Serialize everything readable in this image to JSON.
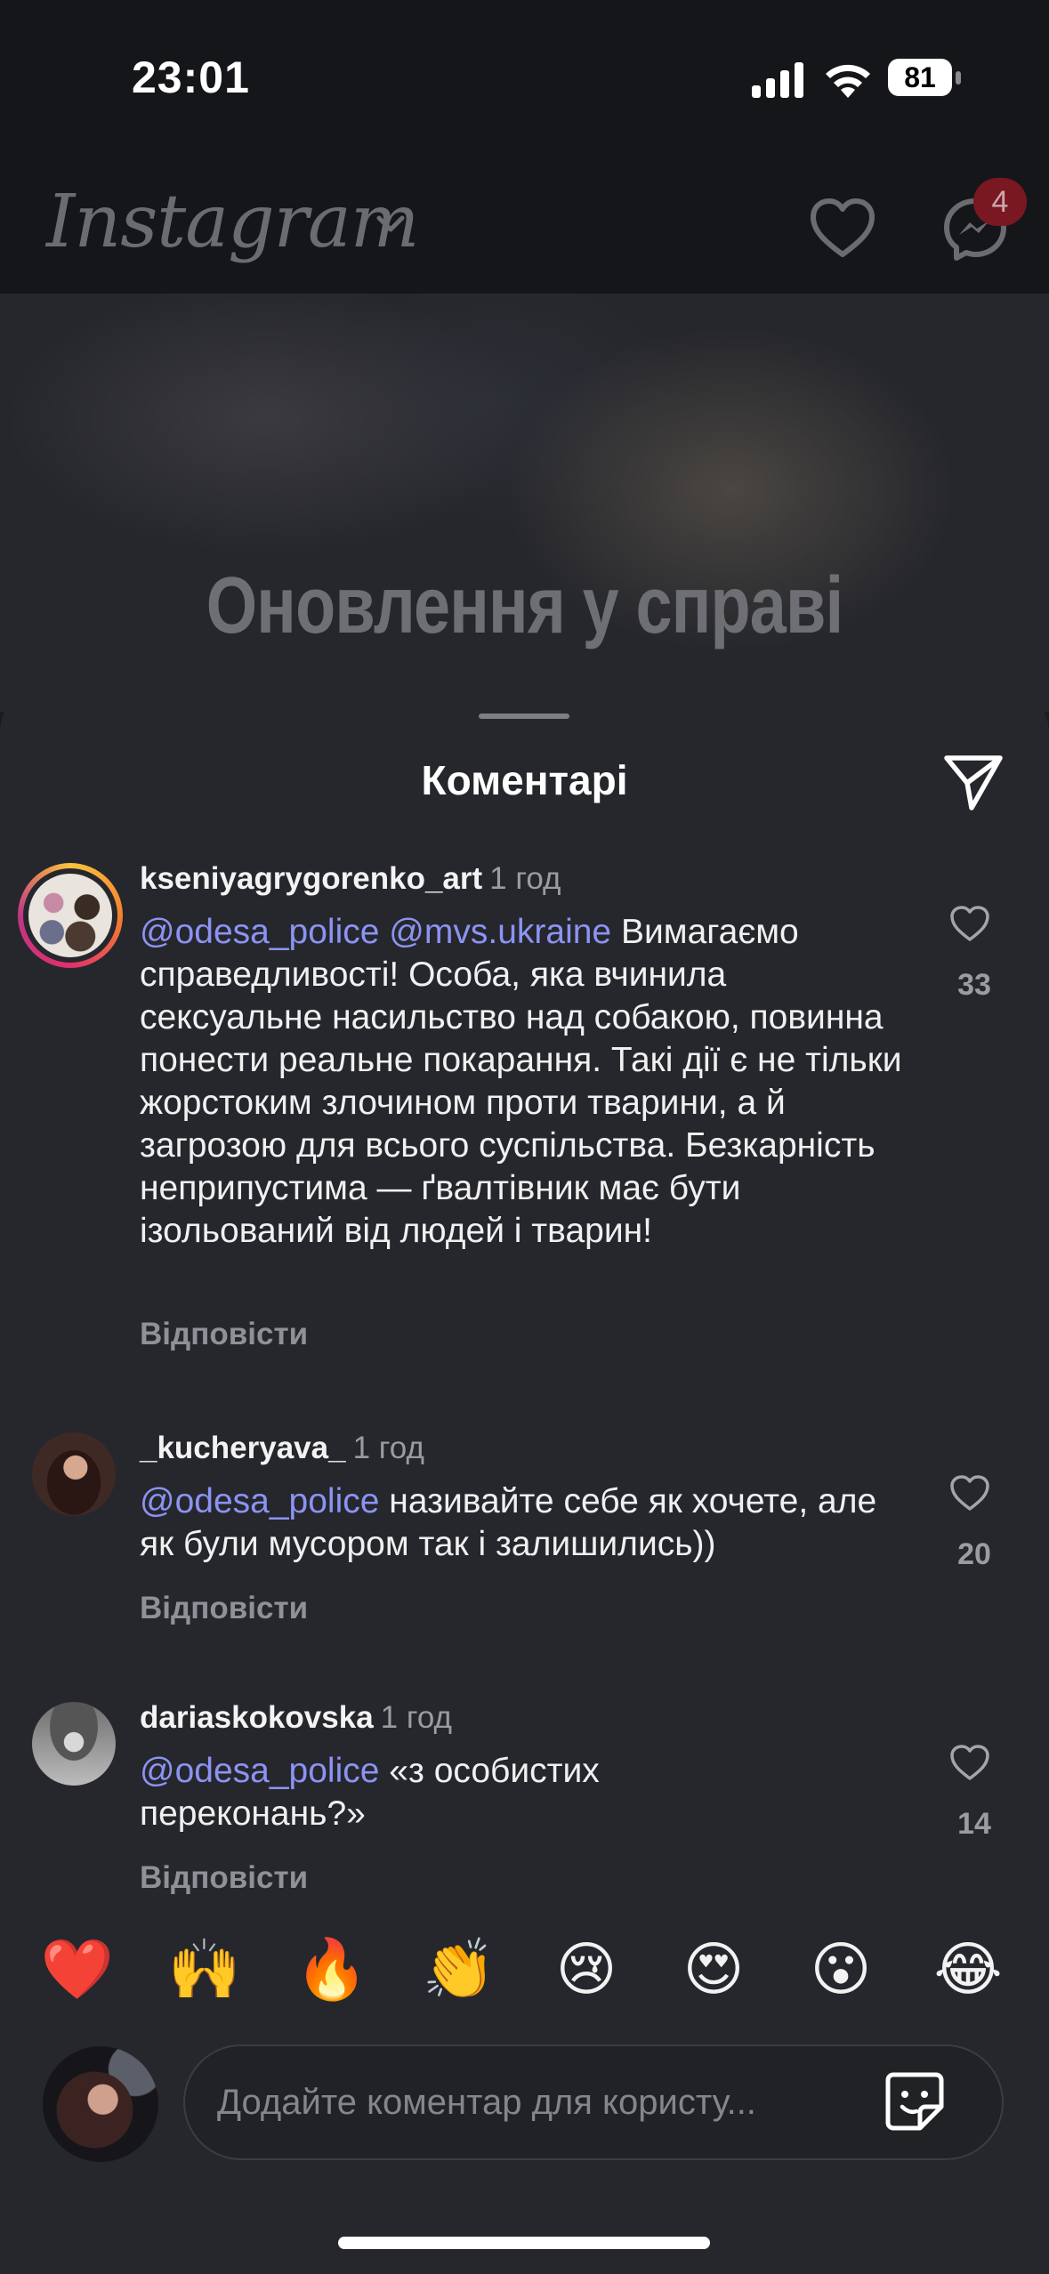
{
  "status_bar": {
    "time": "23:01",
    "battery": "81"
  },
  "header": {
    "logo": "Instagram",
    "messages_badge": "4"
  },
  "post": {
    "overlay_text": "Оновлення у справі"
  },
  "sheet": {
    "title": "Коментарі"
  },
  "comments": [
    {
      "username": "kseniyagrygorenko_art",
      "time": "1 год",
      "mentions": [
        "@odesa_police",
        "@mvs.ukraine"
      ],
      "text": "Вимагаємо справедливості! Особа, яка вчинила сексуальне насильство над собакою, повинна понести реальне покарання. Такі дії є не тільки жорстоким злочином проти тварини, а й загрозою для всього суспільства. Безкарність неприпустима — ґвалтівник має бути ізольований від людей і тварин!",
      "reply": "Відповісти",
      "likes": "33"
    },
    {
      "username": "_kucheryava_",
      "time": "1 год",
      "mentions": [
        "@odesa_police"
      ],
      "text": "називайте себе як хочете, але як були мусором так і залишились))",
      "reply": "Відповісти",
      "likes": "20"
    },
    {
      "username": "dariaskokovska",
      "time": "1 год",
      "mentions": [
        "@odesa_police"
      ],
      "text": "«з особистих переконань?»",
      "reply": "Відповісти",
      "likes": "14"
    }
  ],
  "emoji_bar": [
    "❤️",
    "🙌",
    "🔥",
    "👏",
    "😢",
    "😍",
    "😮",
    "😂"
  ],
  "input": {
    "placeholder": "Додайте коментар для користу..."
  },
  "colors": {
    "sheet": "#25272c",
    "mention": "#8c93f2",
    "muted": "#9a9ca2",
    "badge": "#7a1822"
  }
}
